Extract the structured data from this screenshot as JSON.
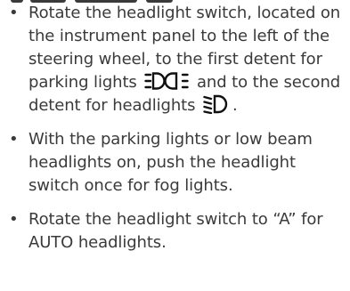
{
  "bullets": [
    {
      "part1": "Rotate the headlight switch, located on the instrument panel to the left of the steering wheel, to the first detent for parking lights",
      "icon1": "parking-lights-icon",
      "part2": "and to the second detent for headlights",
      "icon2": "low-beam-headlights-icon",
      "part3": "."
    },
    {
      "text": "With the parking lights or low beam headlights on, push the headlight switch once for fog lights."
    },
    {
      "text": "Rotate the headlight switch to “A” for AUTO headlights."
    }
  ],
  "bullet_glyph": "•",
  "text_color": "#3a3a3a",
  "icon_color": "#111111"
}
